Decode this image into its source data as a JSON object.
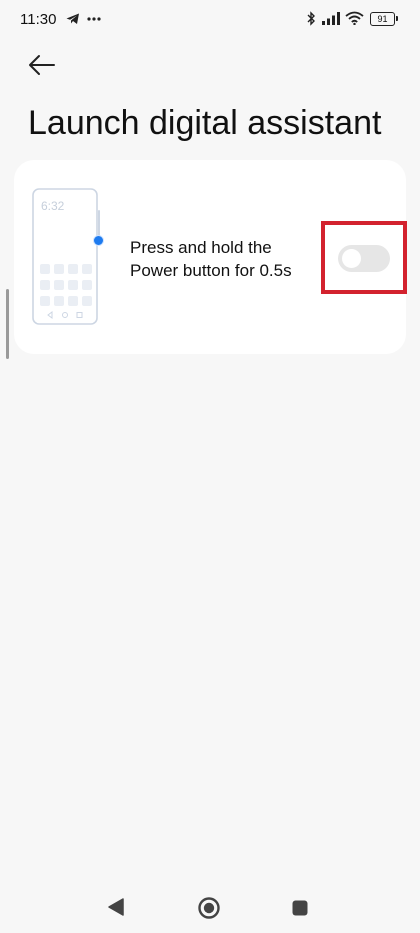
{
  "status_bar": {
    "time": "11:30",
    "battery_level": "91",
    "left_icons": [
      "telegram-icon",
      "more-dots-icon"
    ],
    "right_icons": [
      "bluetooth-icon",
      "signal-icon",
      "wifi-icon",
      "battery-icon"
    ]
  },
  "header": {
    "back_icon": "arrow-left-icon",
    "title": "Launch digital assistant"
  },
  "card": {
    "illustration_time": "6:32",
    "option_text_line1": "Press and hold the",
    "option_text_line2": "Power button for 0.5s",
    "toggle_state": "off"
  },
  "colors": {
    "background": "#f7f7f7",
    "card": "#ffffff",
    "accent_dot": "#1e7bef",
    "toggle_off": "#e6e6e6",
    "highlight": "#d3222e"
  },
  "nav_bar": {
    "icons": [
      "back-triangle-icon",
      "home-circle-icon",
      "recents-square-icon"
    ]
  }
}
